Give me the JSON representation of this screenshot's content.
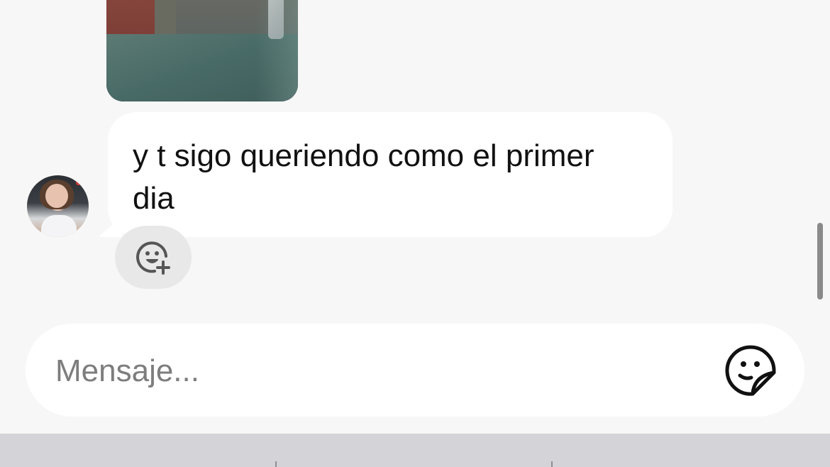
{
  "conversation": {
    "received_message": {
      "text": "y t sigo queriendo como el primer dia",
      "line1": "y t sigo queriendo como el primer",
      "line2": "dia"
    },
    "icons": {
      "avatar": "contact-avatar",
      "reaction": "add-reaction-icon",
      "sticker": "sticker-icon"
    }
  },
  "composer": {
    "placeholder": "Mensaje...",
    "value": ""
  },
  "colors": {
    "background": "#f7f7f7",
    "bubble": "#ffffff",
    "reaction_button": "#e8e8e8",
    "placeholder": "#7d7d7d",
    "keyboard": "#d3d3d8"
  }
}
